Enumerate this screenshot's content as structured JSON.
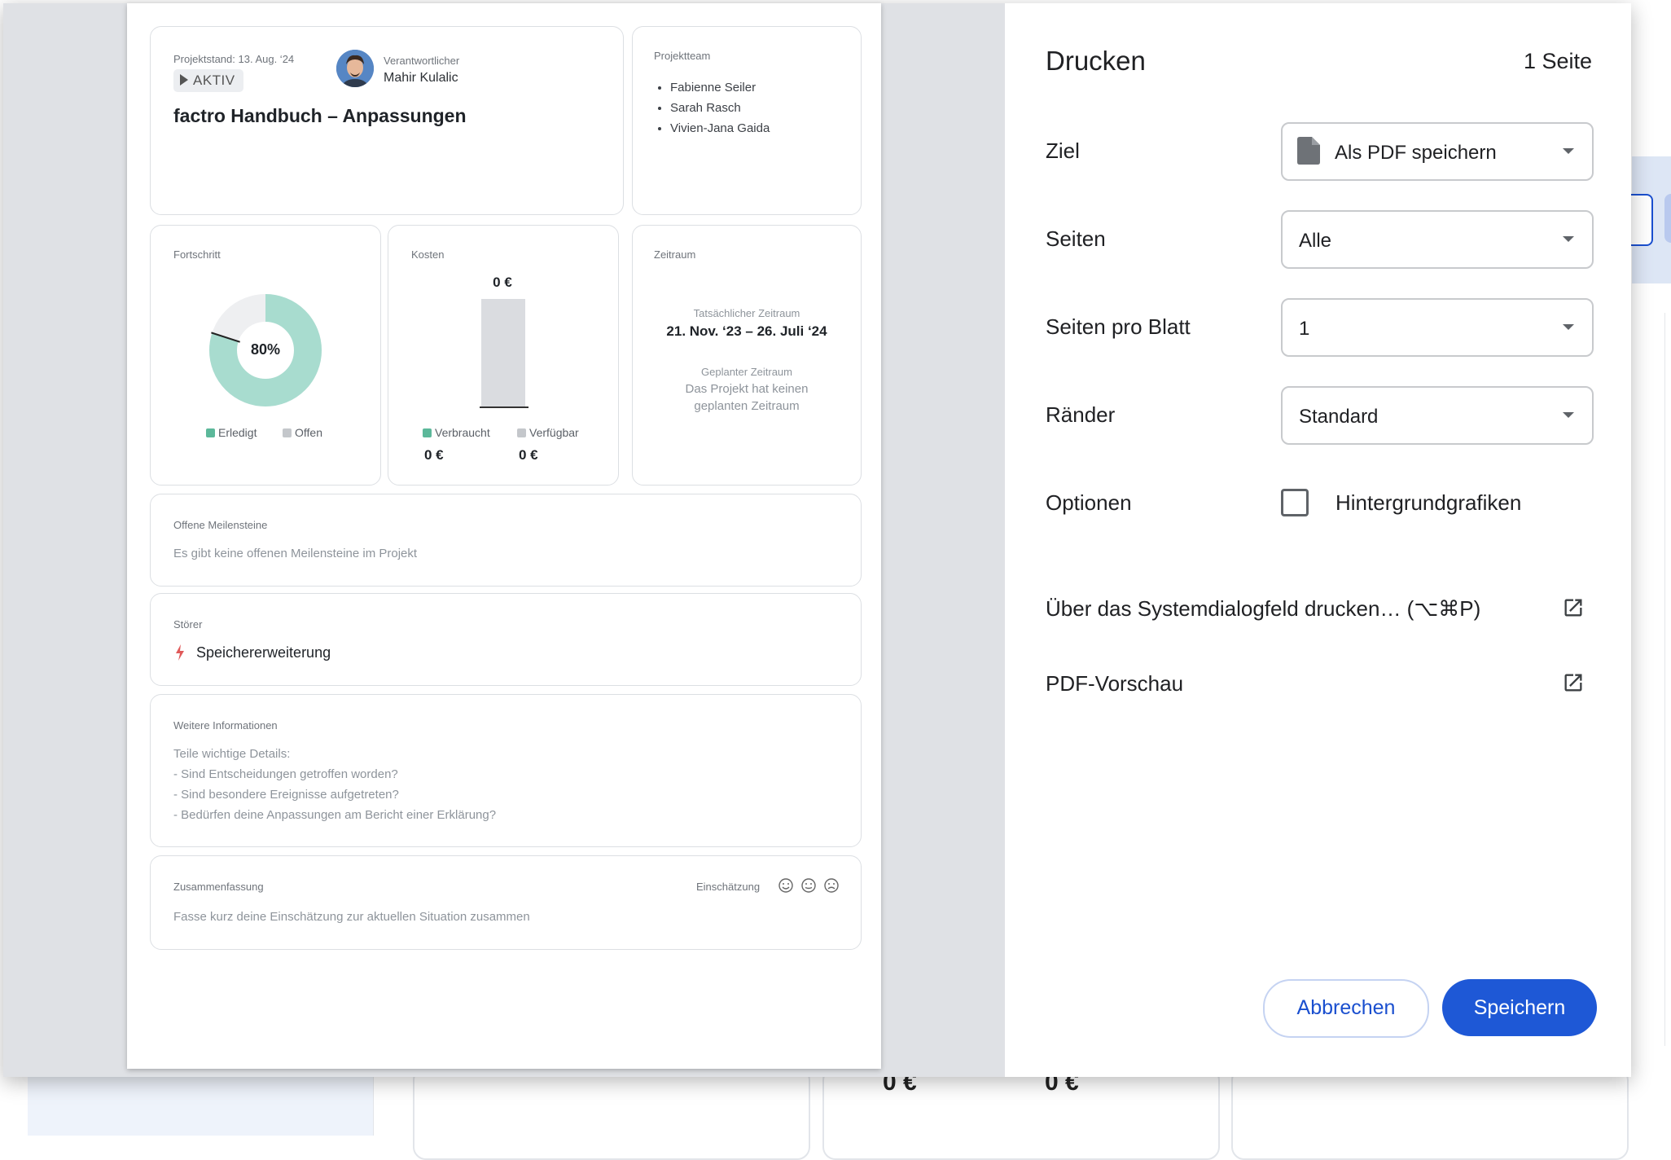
{
  "background": {
    "values": [
      "0 €",
      "0 €"
    ]
  },
  "preview": {
    "header": {
      "status_date": "Projektstand: 13. Aug. ‘24",
      "status_badge": "AKTIV",
      "owner_label": "Verantwortlicher",
      "owner_name": "Mahir Kulalic",
      "project_title": "factro Handbuch – Anpassungen"
    },
    "team": {
      "label": "Projektteam",
      "members": [
        "Fabienne Seiler",
        "Sarah Rasch",
        "Vivien-Jana Gaida"
      ]
    },
    "progress": {
      "label": "Fortschritt",
      "percent": 80,
      "percent_text": "80%",
      "legend_done": "Erledigt",
      "legend_open": "Offen",
      "color_done": "#a8dccf",
      "color_open": "#eeeff1"
    },
    "costs": {
      "label": "Kosten",
      "total": "0 €",
      "legend_used": "Verbraucht",
      "legend_available": "Verfügbar",
      "used_value": "0 €",
      "available_value": "0 €"
    },
    "period": {
      "label": "Zeitraum",
      "actual_label": "Tatsächlicher Zeitraum",
      "actual_value": "21. Nov. ‘23 – 26. Juli ‘24",
      "planned_label": "Geplanter Zeitraum",
      "planned_line1": "Das Projekt hat keinen",
      "planned_line2": "geplanten Zeitraum"
    },
    "milestones": {
      "label": "Offene Meilensteine",
      "text": "Es gibt keine offenen Meilensteine im Projekt"
    },
    "disruptors": {
      "label": "Störer",
      "item": "Speichererweiterung"
    },
    "info": {
      "label": "Weitere Informationen",
      "lines": [
        "Teile wichtige Details:",
        "- Sind Entscheidungen getroffen worden?",
        "- Sind besondere Ereignisse aufgetreten?",
        "- Bedürfen deine Anpassungen am Bericht einer Erklärung?"
      ]
    },
    "summary": {
      "label": "Zusammenfassung",
      "rating_label": "Einschätzung",
      "text": "Fasse kurz deine Einschätzung zur aktuellen Situation zusammen"
    }
  },
  "print": {
    "title": "Drucken",
    "page_count": "1 Seite",
    "destination": {
      "label": "Ziel",
      "value": "Als PDF speichern"
    },
    "pages": {
      "label": "Seiten",
      "value": "Alle"
    },
    "pages_per_sheet": {
      "label": "Seiten pro Blatt",
      "value": "1"
    },
    "margins": {
      "label": "Ränder",
      "value": "Standard"
    },
    "options": {
      "label": "Optionen",
      "checkbox_label": "Hintergrundgrafiken",
      "checked": false
    },
    "system_dialog": "Über das Systemdialogfeld drucken… (⌥⌘P)",
    "pdf_preview": "PDF-Vorschau",
    "cancel": "Abbrechen",
    "save": "Speichern",
    "accent_color": "#1e58d6"
  }
}
